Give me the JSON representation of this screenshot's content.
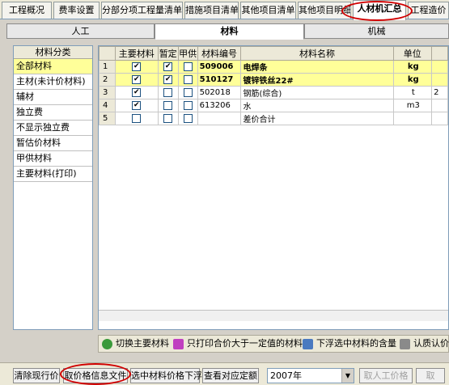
{
  "top_tabs": [
    "工程概况",
    "费率设置",
    "分部分项工程量清单",
    "措施项目清单",
    "其他项目清单",
    "其他项目明细",
    "人材机汇总",
    "工程造价"
  ],
  "sub_tabs": [
    "人工",
    "材料",
    "机械"
  ],
  "left_panel": {
    "header": "材料分类",
    "items": [
      "全部材料",
      "主材(未计价材料)",
      "辅材",
      "独立费",
      "不显示独立费",
      "暂估价材料",
      "甲供材料",
      "主要材料(打印)"
    ]
  },
  "grid": {
    "columns": [
      "",
      "主要材料",
      "暂定",
      "甲供",
      "材料编号",
      "材料名称",
      "单位",
      ""
    ],
    "rows": [
      {
        "n": "1",
        "main": "✔",
        "temp": "✔",
        "jia": "",
        "code": "509006",
        "name": "电焊条",
        "unit": "kg",
        "extra": ""
      },
      {
        "n": "2",
        "main": "✔",
        "temp": "✔",
        "jia": "",
        "code": "510127",
        "name": "镀锌铁丝22#",
        "unit": "kg",
        "extra": ""
      },
      {
        "n": "3",
        "main": "✔",
        "temp": "",
        "jia": "",
        "code": "502018",
        "name": "钢筋(综合)",
        "unit": "t",
        "extra": "2"
      },
      {
        "n": "4",
        "main": "✔",
        "temp": "",
        "jia": "",
        "code": "613206",
        "name": "水",
        "unit": "m3",
        "extra": ""
      },
      {
        "n": "5",
        "main": "",
        "temp": "",
        "jia": "",
        "code": "",
        "name": "差价合计",
        "unit": "",
        "extra": ""
      }
    ]
  },
  "toolbar": {
    "switch_main": "切换主要材料",
    "print_only": "只打印合价大于一定值的材料",
    "float_down": "下浮选中材料的含量",
    "confirm_price": "认质认价"
  },
  "bottom": {
    "clear_price": "清除现行价",
    "price_file": "取价格信息文件",
    "float_selected": "选中材料价格下浮",
    "view_quota": "查看对应定额",
    "year": "2007年",
    "manual_price": "取人工价格",
    "last": "取"
  }
}
